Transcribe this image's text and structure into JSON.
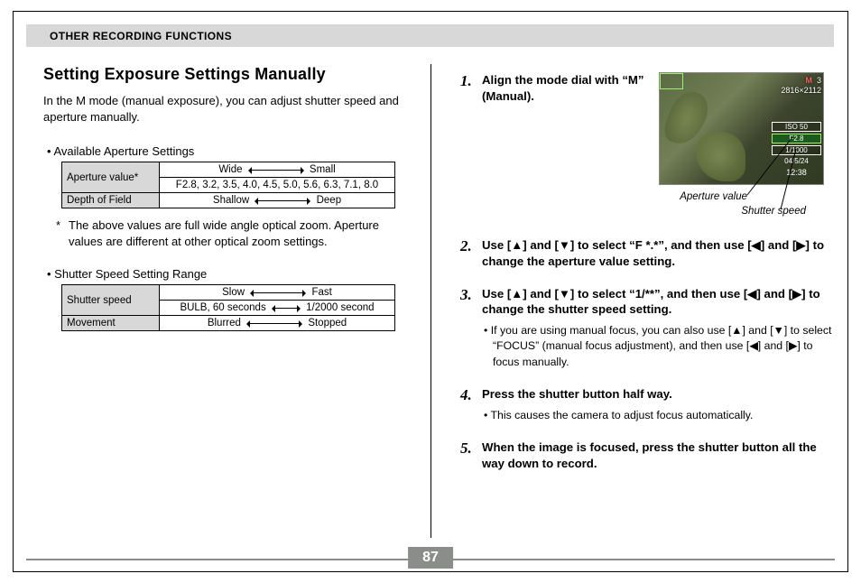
{
  "header": {
    "title": "OTHER RECORDING FUNCTIONS"
  },
  "left": {
    "heading": "Setting Exposure Settings Manually",
    "intro": "In the M mode (manual exposure), you can adjust shutter speed and aperture manually.",
    "apertureTitle": "• Available Aperture Settings",
    "apertureTable": {
      "row1Label": "Aperture value*",
      "row1Left": "Wide",
      "row1Right": "Small",
      "row2Value": "F2.8,  3.2,  3.5,  4.0,  4.5,  5.0,  5.6,  6.3,  7.1,   8.0",
      "row3Label": "Depth of Field",
      "row3Left": "Shallow",
      "row3Right": "Deep"
    },
    "apertureNote": "The above values are full wide angle optical zoom. Aperture values are different at other optical zoom settings.",
    "shutterTitle": "• Shutter Speed Setting Range",
    "shutterTable": {
      "row1Label": "Shutter speed",
      "row1Left": "Slow",
      "row1Right": "Fast",
      "row2Left": "BULB, 60 seconds",
      "row2Right": "1/2000 second",
      "row3Label": "Movement",
      "row3Left": "Blurred",
      "row3Right": "Stopped"
    }
  },
  "right": {
    "lcd": {
      "mode": "M",
      "count": "3",
      "res": "2816×2112",
      "iso": "ISO 50",
      "f": "F2.8",
      "shutter": "1/1000",
      "date": "04/5/24",
      "time": "12:38",
      "capLeft": "Aperture value",
      "capRight": "Shutter speed"
    },
    "steps": [
      {
        "n": "1.",
        "body": "Align the mode dial with “M” (Manual)."
      },
      {
        "n": "2.",
        "body": "Use [▲] and [▼] to select “F *.*”, and then use [◀] and [▶] to change the aperture value setting."
      },
      {
        "n": "3.",
        "body": "Use [▲] and [▼] to select “1/**”, and then use [◀] and [▶] to change the shutter speed setting.",
        "sub": "• If you are using manual focus, you can also use [▲] and [▼] to select “FOCUS” (manual focus adjustment), and then use [◀] and [▶] to focus manually."
      },
      {
        "n": "4.",
        "body": "Press the shutter button half way.",
        "sub": "• This causes the camera to adjust focus automatically."
      },
      {
        "n": "5.",
        "body": "When the image is focused, press the shutter button all the way down to record."
      }
    ]
  },
  "pageNumber": "87"
}
